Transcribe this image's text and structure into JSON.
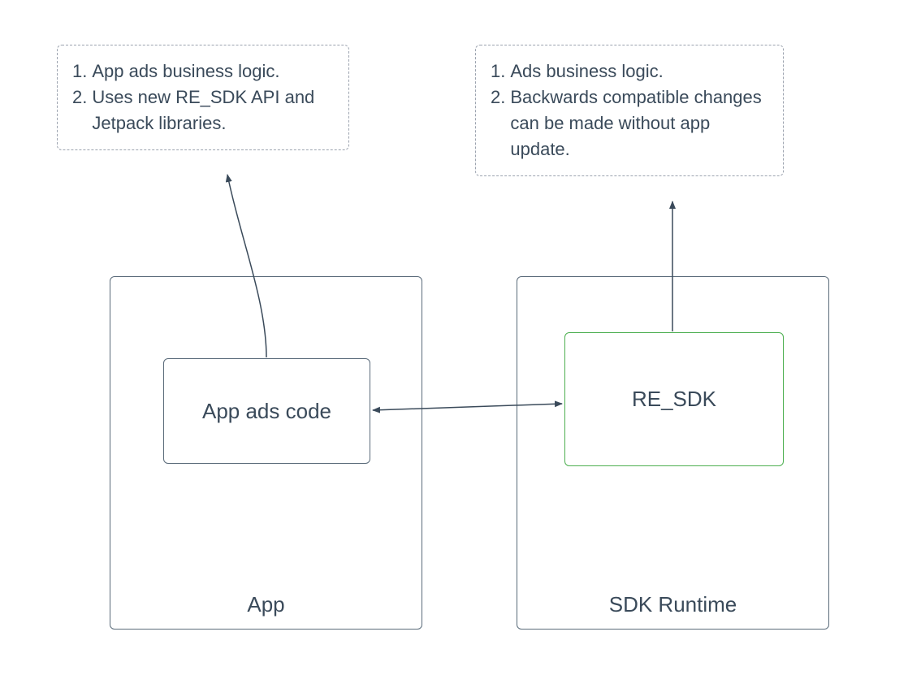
{
  "notes": {
    "left": {
      "item1": "App ads business logic.",
      "item2": "Uses new RE_SDK API and Jetpack libraries."
    },
    "right": {
      "item1": "Ads business logic.",
      "item2": "Backwards compatible changes can be made without app update."
    }
  },
  "containers": {
    "app": {
      "label": "App",
      "inner": "App ads code"
    },
    "runtime": {
      "label": "SDK Runtime",
      "inner": "RE_SDK"
    }
  }
}
